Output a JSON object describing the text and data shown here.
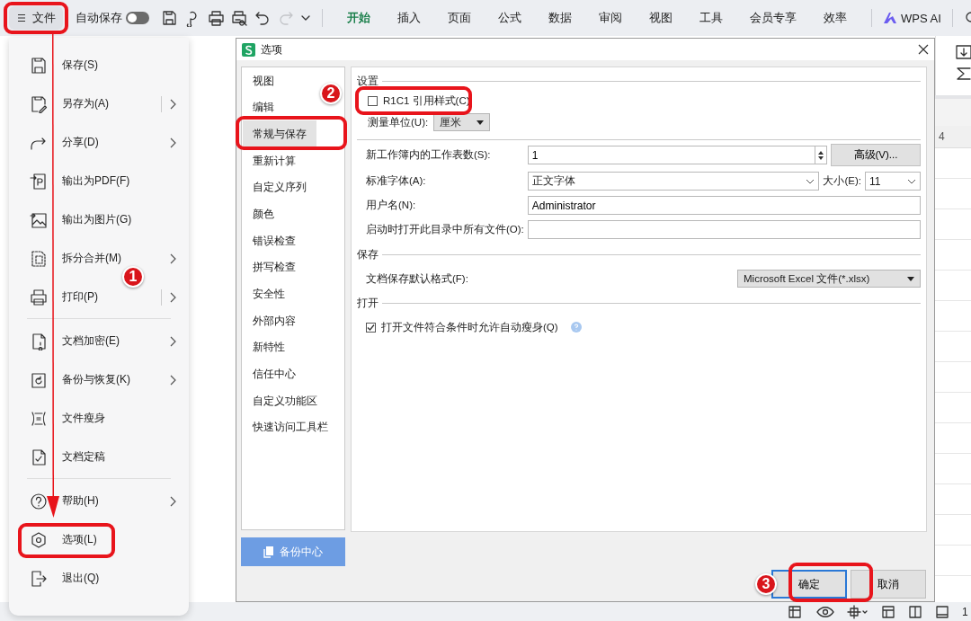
{
  "toolbar": {
    "file_button": {
      "label": "文件"
    },
    "autosave": {
      "label": "自动保存",
      "on": false
    },
    "quick_actions": [
      {
        "disabled": false
      },
      {
        "disabled": false
      },
      {
        "disabled": false
      },
      {
        "disabled": false
      },
      {
        "disabled": false
      },
      {
        "disabled": true
      }
    ],
    "tabs": [
      {
        "label": "开始",
        "selected": true
      },
      {
        "label": "插入",
        "selected": false
      },
      {
        "label": "页面",
        "selected": false
      },
      {
        "label": "公式",
        "selected": false
      },
      {
        "label": "数据",
        "selected": false
      },
      {
        "label": "审阅",
        "selected": false
      },
      {
        "label": "视图",
        "selected": false
      },
      {
        "label": "工具",
        "selected": false
      },
      {
        "label": "会员专享",
        "selected": false
      },
      {
        "label": "效率",
        "selected": false
      }
    ],
    "ai_button": {
      "label": "WPS AI"
    }
  },
  "file_menu": {
    "groups": [
      [
        {
          "label": "保存(S)",
          "submenu": false,
          "split": false
        },
        {
          "label": "另存为(A)",
          "submenu": true,
          "split": true
        },
        {
          "label": "分享(D)",
          "submenu": true,
          "split": false
        },
        {
          "label": "输出为PDF(F)",
          "submenu": false,
          "split": false
        },
        {
          "label": "输出为图片(G)",
          "submenu": false,
          "split": false
        },
        {
          "label": "拆分合并(M)",
          "submenu": true,
          "split": false
        },
        {
          "label": "打印(P)",
          "submenu": true,
          "split": true
        }
      ],
      [
        {
          "label": "文档加密(E)",
          "submenu": true,
          "split": false
        },
        {
          "label": "备份与恢复(K)",
          "submenu": true,
          "split": false
        },
        {
          "label": "文件瘦身",
          "submenu": false,
          "split": false
        },
        {
          "label": "文档定稿",
          "submenu": false,
          "split": false
        }
      ],
      [
        {
          "label": "帮助(H)",
          "submenu": true,
          "split": false
        },
        {
          "label": "选项(L)",
          "submenu": false,
          "split": false
        },
        {
          "label": "退出(Q)",
          "submenu": false,
          "split": false
        }
      ]
    ]
  },
  "dialog": {
    "title": "选项",
    "nav": [
      {
        "label": "视图",
        "selected": false
      },
      {
        "label": "编辑",
        "selected": false
      },
      {
        "label": "常规与保存",
        "selected": true
      },
      {
        "label": "重新计算",
        "selected": false
      },
      {
        "label": "自定义序列",
        "selected": false
      },
      {
        "label": "颜色",
        "selected": false
      },
      {
        "label": "错误检查",
        "selected": false
      },
      {
        "label": "拼写检查",
        "selected": false
      },
      {
        "label": "安全性",
        "selected": false
      },
      {
        "label": "外部内容",
        "selected": false
      },
      {
        "label": "新特性",
        "selected": false
      },
      {
        "label": "信任中心",
        "selected": false
      },
      {
        "label": "自定义功能区",
        "selected": false
      },
      {
        "label": "快速访问工具栏",
        "selected": false
      }
    ],
    "backup_button": "备份中心",
    "settings": {
      "title": "设置",
      "r1c1": {
        "label": "R1C1 引用样式(C)",
        "checked": false
      },
      "unit": {
        "label": "测量单位(U):",
        "value": "厘米"
      }
    },
    "general": {
      "sheets": {
        "label": "新工作簿内的工作表数(S):",
        "value": "1"
      },
      "advanced_button": "高级(V)...",
      "font": {
        "label": "标准字体(A):",
        "value": "正文字体"
      },
      "size": {
        "label": "大小(E):",
        "value": "11"
      },
      "username": {
        "label": "用户名(N):",
        "value": "Administrator"
      },
      "startup_dir": {
        "label": "启动时打开此目录中所有文件(O):"
      }
    },
    "save": {
      "title": "保存",
      "format": {
        "label": "文档保存默认格式(F):",
        "value": "Microsoft Excel 文件(*.xlsx)"
      }
    },
    "open": {
      "title": "打开",
      "auto_slim": {
        "label": "打开文件符合条件时允许自动瘦身(Q)",
        "checked": true
      }
    },
    "buttons": [
      {
        "label": "确定",
        "focused": true
      },
      {
        "label": "取消",
        "focused": false
      }
    ]
  },
  "sheet": {
    "column_header": "4"
  },
  "status_bar": {
    "text": "1"
  },
  "annotations": [
    {
      "label": "1"
    },
    {
      "label": "2"
    },
    {
      "label": "3"
    }
  ]
}
